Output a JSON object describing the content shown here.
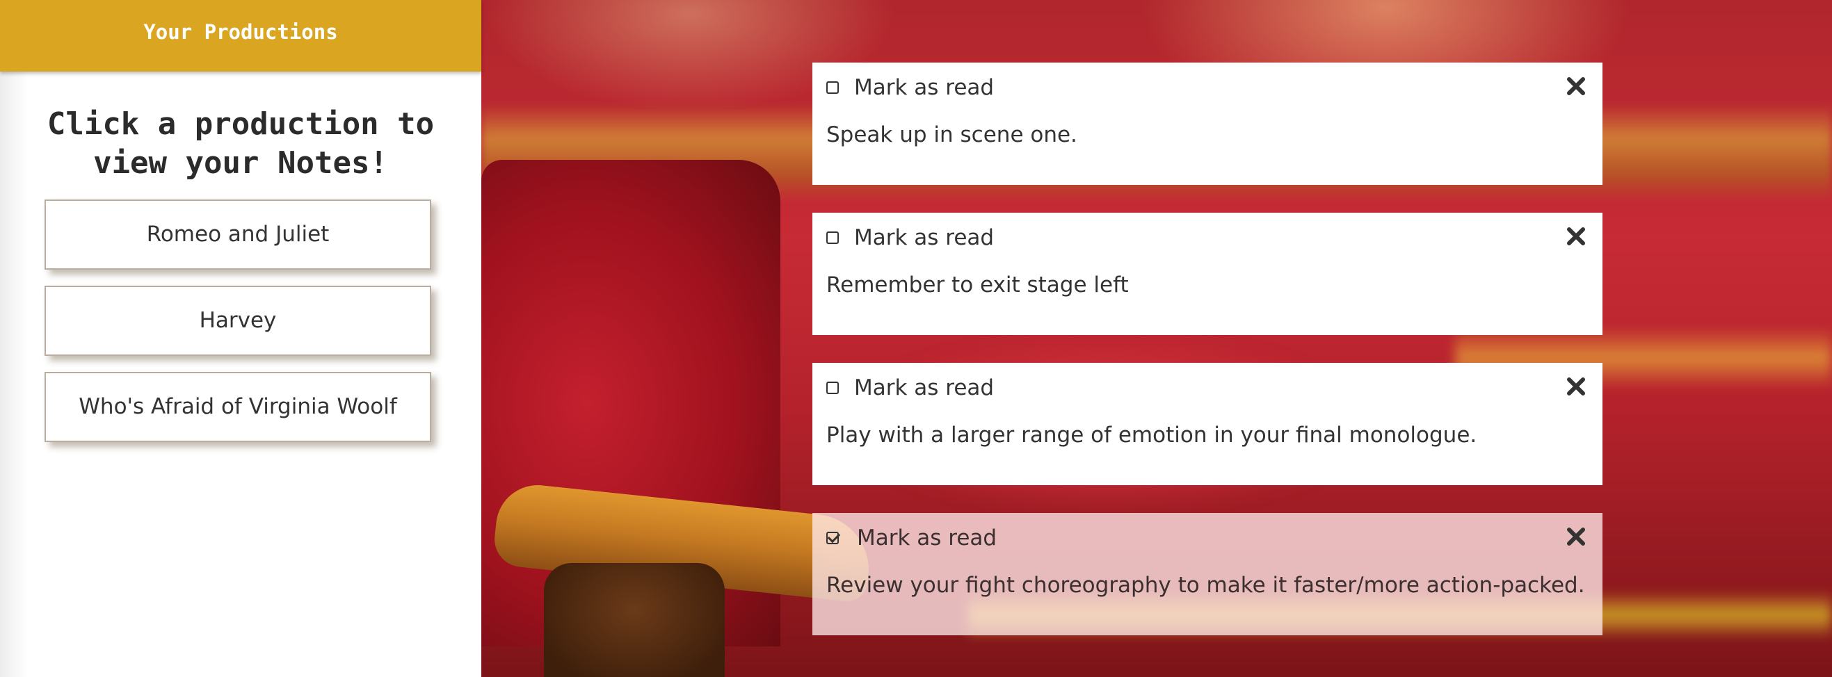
{
  "sidebar": {
    "header_title": "Your Productions",
    "prompt": "Click a production to view your Notes!",
    "productions": [
      {
        "label": "Romeo and Juliet"
      },
      {
        "label": "Harvey"
      },
      {
        "label": "Who's Afraid of Virginia Woolf"
      }
    ]
  },
  "notes": [
    {
      "mark_label": "Mark as read",
      "text": "Speak up in scene one.",
      "read": false
    },
    {
      "mark_label": "Mark as read",
      "text": "Remember to exit stage left",
      "read": false
    },
    {
      "mark_label": "Mark as read",
      "text": "Play with a larger range of emotion in your final monologue.",
      "read": false
    },
    {
      "mark_label": "Mark as read",
      "text": "Review your fight choreography to make it faster/more action-packed.",
      "read": true
    }
  ],
  "icons": {
    "close": "close-icon",
    "checkbox": "checkbox-icon"
  },
  "colors": {
    "header_gold": "#daa520",
    "text_dark": "#333333",
    "card_bg": "#ffffff",
    "read_card_bg": "#ffe8e8"
  }
}
